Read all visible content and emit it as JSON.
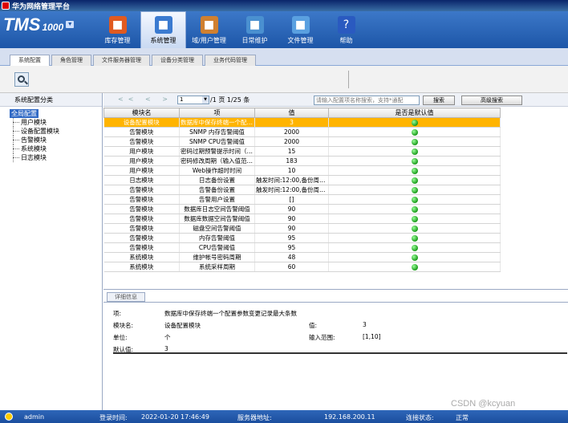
{
  "window": {
    "title": "华为网络管理平台"
  },
  "brand": {
    "name": "TMS",
    "model": "1000"
  },
  "nav": [
    {
      "label": "库存管理",
      "icon": "inventory-icon",
      "color": "#e05a20",
      "active": false
    },
    {
      "label": "系统管理",
      "icon": "system-icon",
      "color": "#3a7ad0",
      "active": true
    },
    {
      "label": "域/用户管理",
      "icon": "users-icon",
      "color": "#d08030",
      "active": false
    },
    {
      "label": "日常维护",
      "icon": "maintenance-icon",
      "color": "#4a90d0",
      "active": false
    },
    {
      "label": "文件管理",
      "icon": "file-icon",
      "color": "#5aa0e0",
      "active": false
    },
    {
      "label": "帮助",
      "icon": "help-icon",
      "color": "#2a5ac0",
      "active": false
    }
  ],
  "tabs": [
    {
      "label": "系统配置",
      "active": true
    },
    {
      "label": "角色管理",
      "active": false
    },
    {
      "label": "文件服务器管理",
      "active": false
    },
    {
      "label": "设备分类管理",
      "active": false
    },
    {
      "label": "业务代码管理",
      "active": false
    }
  ],
  "left_panel": {
    "title": "系统配置分类",
    "root": "全局配置",
    "children": [
      "用户模块",
      "设备配置模块",
      "告警模块",
      "系统模块",
      "日志模块"
    ]
  },
  "pager": {
    "arrows": "<< < > >>",
    "page_value": "1",
    "info": "/1 页 1/25 条",
    "search_placeholder": "请输入配置项名称搜索，支持*通配",
    "search_button": "搜索",
    "advanced_button": "高级搜索"
  },
  "table": {
    "columns": [
      "模块名",
      "项",
      "值",
      "是否是默认值"
    ],
    "rows": [
      {
        "module": "设备配置模块",
        "item": "数据库中保存终端一个配置参数变更记录最大条数",
        "value": "3",
        "default": true,
        "selected": true
      },
      {
        "module": "告警模块",
        "item": "SNMP 内存告警阈值",
        "value": "2000",
        "default": true
      },
      {
        "module": "告警模块",
        "item": "SNMP CPU告警阈值",
        "value": "2000",
        "default": true
      },
      {
        "module": "用户模块",
        "item": "密码过期预警提示时间（天）",
        "value": "15",
        "default": true
      },
      {
        "module": "用户模块",
        "item": "密码修改周期（输入值范围）",
        "value": "183",
        "default": true
      },
      {
        "module": "用户模块",
        "item": "Web操作超时时间",
        "value": "10",
        "default": true
      },
      {
        "module": "日志模块",
        "item": "日志备份设置",
        "value": "触发时间:12:00,备份周期(天)",
        "default": true
      },
      {
        "module": "告警模块",
        "item": "告警备份设置",
        "value": "触发时间:12:00,备份周期(天)",
        "default": true
      },
      {
        "module": "告警模块",
        "item": "告警用户设置",
        "value": "[]",
        "default": true
      },
      {
        "module": "告警模块",
        "item": "数据库日志空间告警阈值",
        "value": "90",
        "default": true
      },
      {
        "module": "告警模块",
        "item": "数据库数据空间告警阈值",
        "value": "90",
        "default": true
      },
      {
        "module": "告警模块",
        "item": "磁盘空间告警阈值",
        "value": "90",
        "default": true
      },
      {
        "module": "告警模块",
        "item": "内存告警阈值",
        "value": "95",
        "default": true
      },
      {
        "module": "告警模块",
        "item": "CPU告警阈值",
        "value": "95",
        "default": true
      },
      {
        "module": "系统模块",
        "item": "维护帐号密码周期",
        "value": "48",
        "default": true
      },
      {
        "module": "系统模块",
        "item": "系统采样周期",
        "value": "60",
        "default": true
      }
    ]
  },
  "details": {
    "tab": "详细信息",
    "item_label": "项:",
    "item_value": "数据库中保存终端一个配置参数变更记录最大条数",
    "module_label": "模块名:",
    "module_value": "设备配置模块",
    "value_label": "值:",
    "value_value": "3",
    "unit_label": "单位:",
    "unit_value": "个",
    "range_label": "输入范围:",
    "range_value": "[1,10]",
    "default_label": "默认值:",
    "default_value": "3"
  },
  "status": {
    "user": "admin",
    "login_label": "登录时间:",
    "login_time": "2022-01-20 17:46:49",
    "server_label": "服务器地址:",
    "server_ip": "192.168.200.11",
    "conn_label": "连接状态:",
    "conn_value": "正常"
  },
  "watermark": "CSDN @kcyuan"
}
